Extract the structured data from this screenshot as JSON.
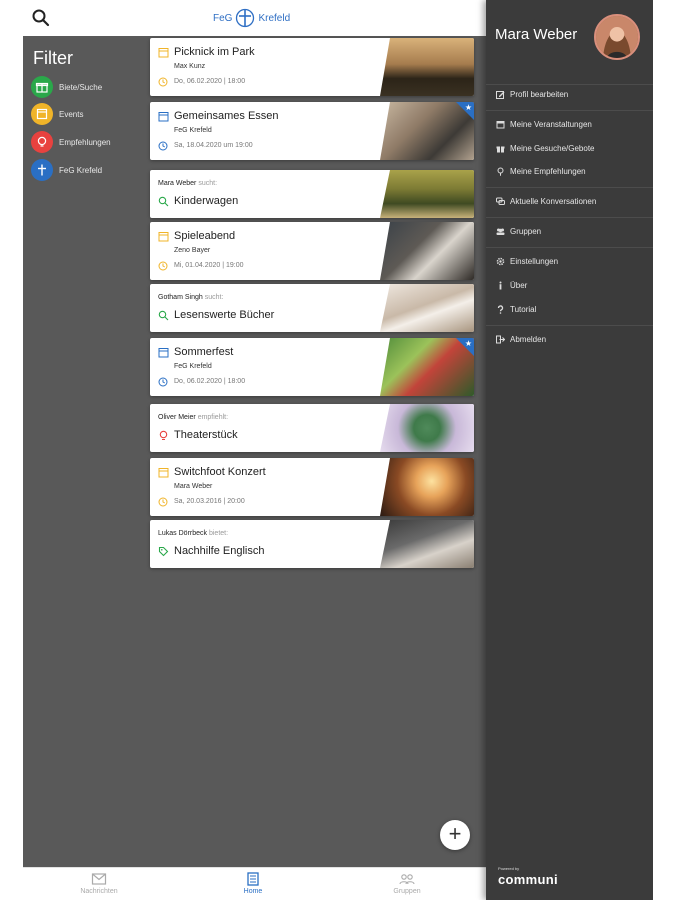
{
  "header": {
    "logo_left": "FeG",
    "logo_right": "Krefeld"
  },
  "filter": {
    "title": "Filter",
    "items": [
      {
        "label": "Biete/Suche",
        "color": "#2aa84a"
      },
      {
        "label": "Events",
        "color": "#f0b429"
      },
      {
        "label": "Empfehlungen",
        "color": "#e8423f"
      },
      {
        "label": "FeG Krefeld",
        "color": "#2a6fc4"
      }
    ]
  },
  "feed": {
    "cards": [
      {
        "type": "event",
        "title": "Picknick im Park",
        "sub": "Max Kunz",
        "date": "Do, 06.02.2020 | 18:00",
        "icon_color": "#f0b429"
      },
      {
        "type": "event",
        "title": "Gemeinsames Essen",
        "sub": "FeG Krefeld",
        "date": "Sa, 18.04.2020 um 19:00",
        "icon_color": "#2a6fc4",
        "starred": true
      },
      {
        "type": "offer",
        "who": "Mara Weber",
        "verb": "sucht:",
        "title": "Kinderwagen",
        "icon_color": "#2aa84a"
      },
      {
        "type": "event",
        "title": "Spieleabend",
        "sub": "Zeno Bayer",
        "date": "Mi, 01.04.2020 | 19:00",
        "icon_color": "#f0b429"
      },
      {
        "type": "offer",
        "who": "Gotham Singh",
        "verb": "sucht:",
        "title": "Lesenswerte Bücher",
        "icon_color": "#2aa84a"
      },
      {
        "type": "event",
        "title": "Sommerfest",
        "sub": "FeG Krefeld",
        "date": "Do, 06.02.2020 | 18:00",
        "icon_color": "#2a6fc4",
        "starred": true
      },
      {
        "type": "offer",
        "who": "Oliver Meier",
        "verb": "empfiehlt:",
        "title": "Theaterstück",
        "icon_color": "#e8423f"
      },
      {
        "type": "event",
        "title": "Switchfoot Konzert",
        "sub": "Mara Weber",
        "date": "Sa, 20.03.2016 | 20:00",
        "icon_color": "#f0b429"
      },
      {
        "type": "offer",
        "who": "Lukas Dörrbeck",
        "verb": "bietet:",
        "title": "Nachhilfe Englisch",
        "icon_color": "#2aa84a"
      }
    ]
  },
  "bottom_nav": {
    "items": [
      {
        "label": "Nachrichten"
      },
      {
        "label": "Home"
      },
      {
        "label": "Gruppen"
      }
    ]
  },
  "drawer": {
    "profile_name": "Mara Weber",
    "menu": [
      {
        "label": "Profil bearbeiten",
        "icon": "edit-icon"
      },
      {
        "label": "Meine Veranstaltungen",
        "icon": "calendar-icon"
      },
      {
        "label": "Meine Gesuche/Gebote",
        "icon": "gift-icon"
      },
      {
        "label": "Meine Empfehlungen",
        "icon": "pin-icon"
      },
      {
        "label": "Aktuelle Konversationen",
        "icon": "chat-icon"
      },
      {
        "label": "Gruppen",
        "icon": "group-icon"
      },
      {
        "label": "Einstellungen",
        "icon": "gear-icon"
      },
      {
        "label": "Über",
        "icon": "info-icon"
      },
      {
        "label": "Tutorial",
        "icon": "question-icon"
      },
      {
        "label": "Abmelden",
        "icon": "logout-icon"
      }
    ],
    "powered_by": "Powered by",
    "brand": "communi"
  }
}
